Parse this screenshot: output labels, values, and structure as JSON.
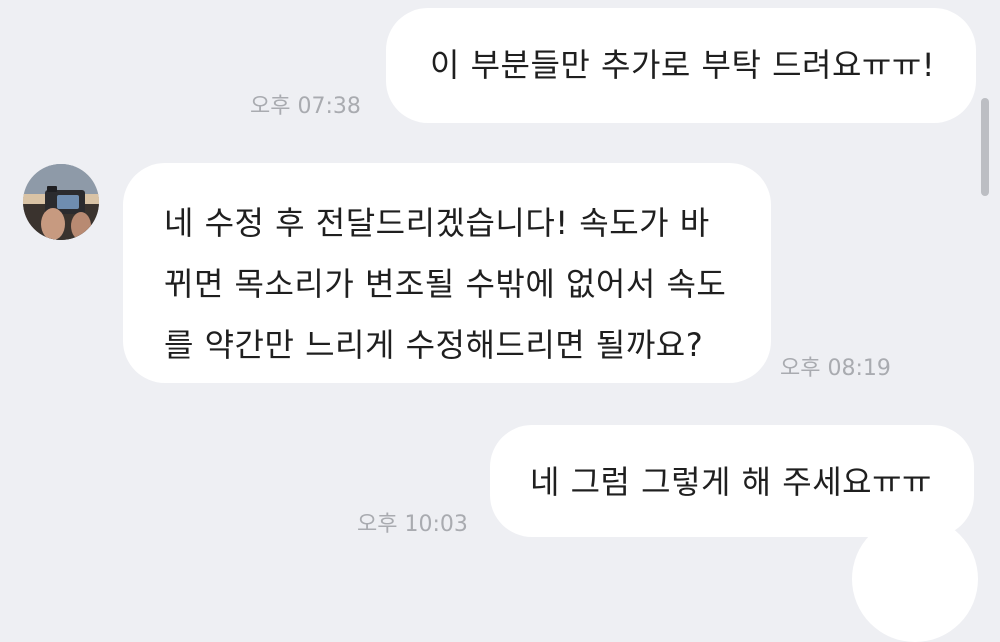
{
  "messages": [
    {
      "direction": "outgoing",
      "text": "이 부분들만 추가로 부탁 드려요ㅠㅠ!",
      "time": "오후 07:38"
    },
    {
      "direction": "incoming",
      "lines": [
        "네 수정 후 전달드리겠습니다! 속도가 바",
        "뀌면 목소리가 변조될 수밖에 없어서 속도",
        "를 약간만 느리게 수정해드리면 될까요?"
      ],
      "time": "오후 08:19"
    },
    {
      "direction": "outgoing",
      "text": "네 그럼 그렇게 해 주세요ㅠㅠ",
      "time": "오후 10:03"
    }
  ],
  "colors": {
    "background": "#eeeff3",
    "bubble": "#ffffff",
    "text": "#1f1f1f",
    "timestamp": "#a9abb0"
  }
}
